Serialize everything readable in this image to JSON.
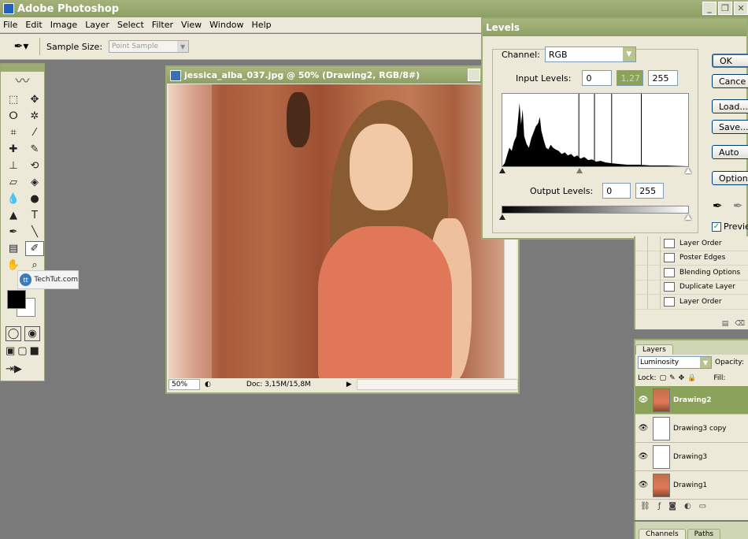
{
  "app": {
    "title": "Adobe Photoshop"
  },
  "menu": [
    "File",
    "Edit",
    "Image",
    "Layer",
    "Select",
    "Filter",
    "View",
    "Window",
    "Help"
  ],
  "options": {
    "sample_size_label": "Sample Size:",
    "sample_size_value": "Point Sample"
  },
  "watermark": "TechTut.com",
  "document": {
    "title": "jessica_alba_037.jpg @ 50% (Drawing2, RGB/8#)",
    "zoom": "50%",
    "doc_info": "Doc: 3,15M/15,8M"
  },
  "levels": {
    "title": "Levels",
    "channel_label": "Channel:",
    "channel_value": "RGB",
    "input_label": "Input Levels:",
    "input_black": "0",
    "input_gamma": "1,27",
    "input_white": "255",
    "output_label": "Output Levels:",
    "output_black": "0",
    "output_white": "255",
    "buttons": {
      "ok": "OK",
      "cancel": "Cance",
      "load": "Load...",
      "save": "Save...",
      "auto": "Auto",
      "options": "Options"
    },
    "preview_label": "Preview"
  },
  "actions": {
    "items": [
      "Layer Order",
      "Poster Edges",
      "Blending Options",
      "Duplicate Layer",
      "Layer Order"
    ]
  },
  "layers": {
    "tab": "Layers",
    "blend_mode": "Luminosity",
    "opacity_label": "Opacity:",
    "lock_label": "Lock:",
    "fill_label": "Fill:",
    "items": [
      "Drawing2",
      "Drawing3 copy",
      "Drawing3",
      "Drawing1"
    ]
  },
  "bottom_tabs": [
    "Channels",
    "Paths"
  ]
}
